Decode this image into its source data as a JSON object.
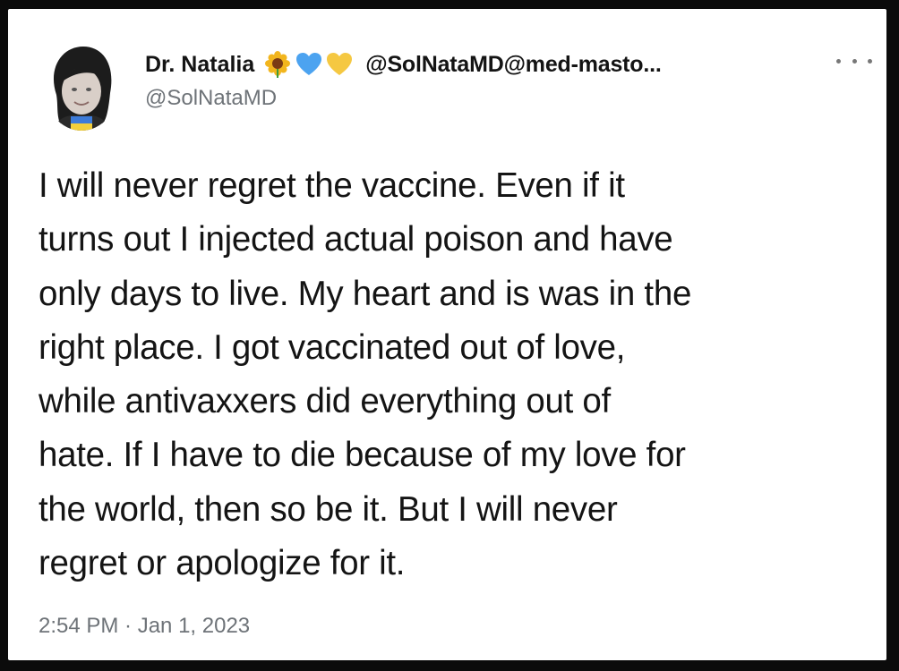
{
  "tweet": {
    "display_name": "Dr. Natalia",
    "name_emojis": [
      "sunflower-icon",
      "blue-heart-icon",
      "yellow-heart-icon"
    ],
    "mastodon_handle": "@SolNataMD@med-masto...",
    "handle": "@SolNataMD",
    "text_lines": [
      "I will never regret the vaccine. Even if it",
      "turns out I injected actual poison and have",
      "only days to live. My heart and is was in the",
      "right place. I got vaccinated out of love,",
      "while antivaxxers did everything out of",
      "hate. If I have to die because of my love for",
      "the world, then so be it. But I will never",
      "regret or apologize for it."
    ],
    "timestamp": "2:54 PM · Jan 1, 2023",
    "more_icon": "more-horizontal-icon"
  },
  "colors": {
    "background": "#0b0b0b",
    "card": "#ffffff",
    "text": "#141414",
    "muted": "#6e7378",
    "blue_heart": "#4ca3f0",
    "yellow_heart": "#f5c842"
  }
}
